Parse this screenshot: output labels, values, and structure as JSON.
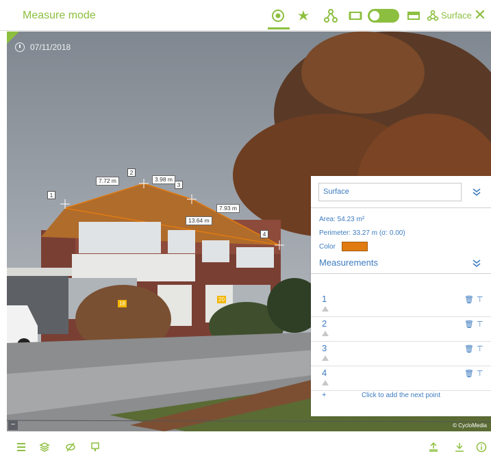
{
  "header": {
    "title": "Measure mode",
    "surface_label": "Surface",
    "close_symbol": "✕",
    "icons": [
      "target-icon",
      "point-icon",
      "network-icon",
      "rect-icon",
      "toggle",
      "rect-filled-icon",
      "surface-icon"
    ]
  },
  "viewer": {
    "date": "07/11/2018",
    "copyright": "© CycloMedia",
    "measure_labels": [
      "7.72 m",
      "3.98 m",
      "7.93 m",
      "13.64 m"
    ],
    "point_numbers": [
      "1",
      "2",
      "3",
      "4"
    ],
    "orange_tags": [
      "18",
      "20"
    ],
    "minus": "–"
  },
  "panel": {
    "dropdown_value": "Surface",
    "area": "Area: 54.23 m²",
    "perimeter": "Perimeter: 33.27 m (σ: 0.00)",
    "color_label": "Color",
    "color_value": "#e07b12",
    "measurements_title": "Measurements",
    "points": [
      "1",
      "2",
      "3",
      "4"
    ],
    "add_plus": "+",
    "add_text": "Click to add the next point"
  },
  "colors": {
    "accent": "#8cbf3f",
    "link": "#3c7bbf",
    "roof_outline": "#e07b12"
  }
}
